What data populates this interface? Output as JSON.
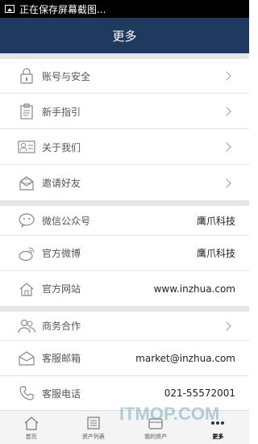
{
  "status_bar": {
    "text": "正在保存屏幕截图..."
  },
  "title": "更多",
  "sections": {
    "account": [
      {
        "label": "账号与安全",
        "icon": "lock-icon"
      },
      {
        "label": "新手指引",
        "icon": "clipboard-icon"
      },
      {
        "label": "关于我们",
        "icon": "id-card-icon"
      },
      {
        "label": "邀请好友",
        "icon": "envelope-open-icon"
      }
    ],
    "social": [
      {
        "label": "微信公众号",
        "value": "鹰爪科技",
        "icon": "wechat-icon"
      },
      {
        "label": "官方微博",
        "value": "鹰爪科技",
        "icon": "weibo-icon"
      },
      {
        "label": "官方网站",
        "value": "www.inzhua.com",
        "icon": "home-icon"
      }
    ],
    "contact": [
      {
        "label": "商务合作",
        "icon": "people-icon"
      },
      {
        "label": "客服邮箱",
        "value": "market@inzhua.com",
        "icon": "mail-icon"
      },
      {
        "label": "客服电话",
        "value": "021-55572001",
        "icon": "phone-icon"
      }
    ]
  },
  "tabs": [
    {
      "label": "首页",
      "icon": "home-tab-icon"
    },
    {
      "label": "资产列表",
      "icon": "list-tab-icon"
    },
    {
      "label": "我的资产",
      "icon": "wallet-tab-icon"
    },
    {
      "label": "更多",
      "icon": "more-tab-icon",
      "active": true
    }
  ],
  "watermark": "ITMOP.COM"
}
